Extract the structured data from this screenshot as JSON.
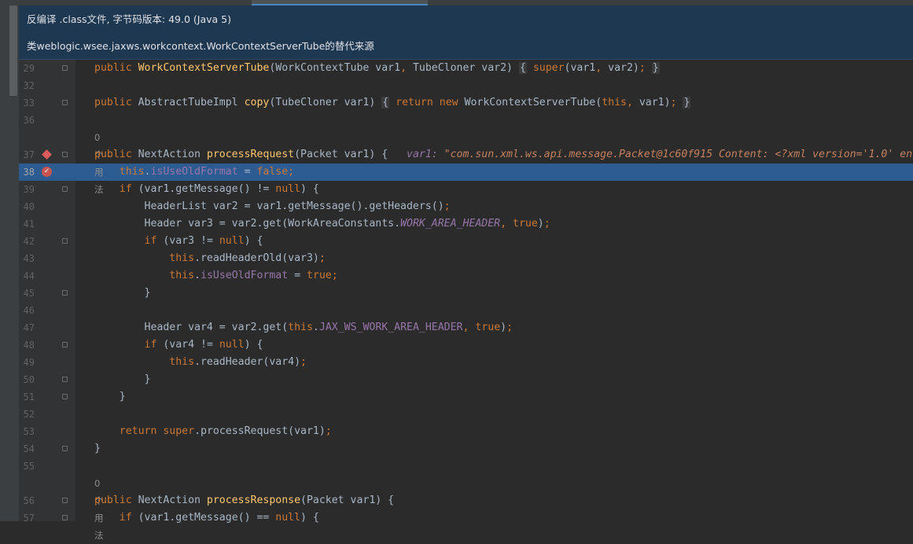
{
  "tabs": [
    "",
    "",
    ""
  ],
  "banner": {
    "line1": "反编译 .class文件, 字节码版本: 49.0 (Java 5)",
    "line2": "类weblogic.wsee.jaxws.workcontext.WorkContextServerTube的替代来源"
  },
  "hint_label": "0 个用法",
  "lines": [
    {
      "no": "29"
    },
    {
      "no": "32"
    },
    {
      "no": "33"
    },
    {
      "no": "36"
    },
    {
      "no": "37"
    },
    {
      "no": "38"
    },
    {
      "no": "39"
    },
    {
      "no": "40"
    },
    {
      "no": "41"
    },
    {
      "no": "42"
    },
    {
      "no": "43"
    },
    {
      "no": "44"
    },
    {
      "no": "45"
    },
    {
      "no": "46"
    },
    {
      "no": "47"
    },
    {
      "no": "48"
    },
    {
      "no": "49"
    },
    {
      "no": "50"
    },
    {
      "no": "51"
    },
    {
      "no": "52"
    },
    {
      "no": "53"
    },
    {
      "no": "54"
    },
    {
      "no": "55"
    },
    {
      "no": "56"
    },
    {
      "no": "57"
    }
  ],
  "code": {
    "l29": {
      "kw_public": "public",
      "fn": "WorkContextServerTube",
      "p1": "(WorkContextTube var1",
      "comma": ",",
      "p2": " TubeCloner var2) ",
      "ob": "{",
      "sp": " ",
      "kw_super": "super",
      "args": "(var1",
      "comma2": ",",
      "args2": " var2)",
      "semi": ";",
      "cb": "}"
    },
    "l33": {
      "kw_public": "public",
      "type": " AbstractTubeImpl ",
      "fn": "copy",
      "params": "(TubeCloner var1) ",
      "ob": "{",
      "kw_return": "return",
      "kw_new": "new",
      "ctor": " WorkContextServerTube(",
      "kw_this": "this",
      "comma": ",",
      "rest": " var1)",
      "semi": ";",
      "cb": "}"
    },
    "l37": {
      "kw_public": "public",
      "type": " NextAction ",
      "fn": "processRequest",
      "params": "(Packet var1) {",
      "inline_var": "var1: ",
      "inline_val": "\"com.sun.xml.ws.api.message.Packet@1c60f915 Content: <?xml version='1.0' en"
    },
    "l38": {
      "kw_this": "this",
      "dot": ".",
      "fld": "isUseOldFormat",
      "eq": " = ",
      "kw_false": "false",
      "semi": ";"
    },
    "l39": {
      "kw_if": "if",
      "cond": " (var1.getMessage() != ",
      "kw_null": "null",
      "rest": ") {"
    },
    "l40": {
      "text": "HeaderList var2 = var1.getMessage().getHeaders()",
      "semi": ";"
    },
    "l41": {
      "a": "Header var3 = var2.get(WorkAreaConstants.",
      "fld": "WORK_AREA_HEADER",
      "comma": ",",
      "kw_true": "true",
      "b": ")",
      "semi": ";"
    },
    "l42": {
      "kw_if": "if",
      "cond": " (var3 != ",
      "kw_null": "null",
      "rest": ") {"
    },
    "l43": {
      "kw_this": "this",
      "rest": ".readHeaderOld(var3)",
      "semi": ";"
    },
    "l44": {
      "kw_this": "this",
      "dot": ".",
      "fld": "isUseOldFormat",
      "eq": " = ",
      "kw_true": "true",
      "semi": ";"
    },
    "l45": {
      "cb": "}"
    },
    "l47": {
      "a": "Header var4 = var2.get(",
      "kw_this": "this",
      "dot": ".",
      "fld": "JAX_WS_WORK_AREA_HEADER",
      "comma": ",",
      "kw_true": "true",
      "b": ")",
      "semi": ";"
    },
    "l48": {
      "kw_if": "if",
      "cond": " (var4 != ",
      "kw_null": "null",
      "rest": ") {"
    },
    "l49": {
      "kw_this": "this",
      "rest": ".readHeader(var4)",
      "semi": ";"
    },
    "l50": {
      "cb": "}"
    },
    "l51": {
      "cb": "}"
    },
    "l53": {
      "kw_return": "return",
      "kw_super": "super",
      "rest": ".processRequest(var1)",
      "semi": ";"
    },
    "l54": {
      "cb": "}"
    },
    "l56": {
      "kw_public": "public",
      "type": " NextAction ",
      "fn": "processResponse",
      "params": "(Packet var1) {"
    },
    "l57": {
      "kw_if": "if",
      "cond": " (var1.getMessage() == ",
      "kw_null": "null",
      "rest": ") {"
    }
  }
}
